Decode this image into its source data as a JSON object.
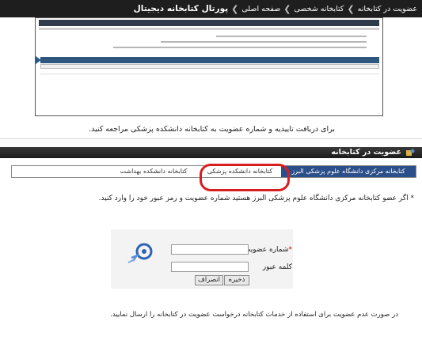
{
  "breadcrumb": {
    "title": "پورتال کتابخانه دیجیتال",
    "items": [
      "صفحه اصلی",
      "کتابخانه شخصی",
      "عضویت در کتابخانه"
    ]
  },
  "top_note": "برای دریافت تاییدیه و شماره عضویت به کتابخانه دانشکده پزشکی مراجعه کنید.",
  "section": {
    "title": "عضویت در کتابخانه",
    "icon": "membership-icon"
  },
  "tabs": [
    {
      "label": "کتابخانه مرکزی دانشگاه علوم پزشکی البرز",
      "active": true
    },
    {
      "label": "کتابخانه دانشکده پزشکی",
      "active": false
    },
    {
      "label": "کتابخانه دانشکده بهداشت",
      "active": false
    }
  ],
  "info_text": "* اگر عضو کتابخانه مرکزی دانشگاه علوم پزشکی البرز هستید شماره عضویت و رمز عبور خود را وارد کنید.",
  "login": {
    "member_label": "شماره عضویت",
    "required_mark": "*",
    "password_label": "کلمه عبور",
    "member_value": "",
    "password_value": "",
    "save_label": "ذخیره",
    "cancel_label": "انصراف"
  },
  "footnote": "در صورت عدم عضویت برای استفاده از خدمات کتابخانه درخواست عضویت در کتابخانه را ارسال نمایید.",
  "colors": {
    "dark_bar": "#1e1e1e",
    "active_tab": "#2b4f8a",
    "highlight_circle": "#d81e1e"
  }
}
